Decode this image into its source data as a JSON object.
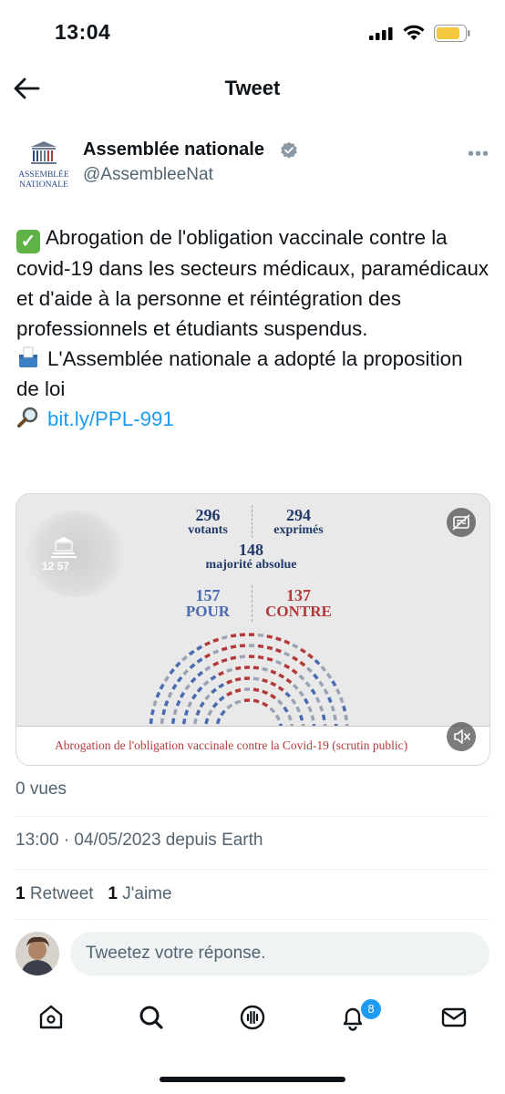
{
  "status_bar": {
    "time": "13:04"
  },
  "header": {
    "title": "Tweet"
  },
  "author": {
    "logo_text_line1": "ASSEMBLÉE",
    "logo_text_line2": "NATIONALE",
    "name": "Assemblée nationale",
    "handle": "@AssembleeNat",
    "verified": true,
    "more_label": "•••"
  },
  "tweet": {
    "emoji_check": "✓",
    "line1": "Abrogation de l'obligation vaccinale contre la covid-19 dans les secteurs médicaux, paramédicaux et d'aide à la personne et réintégration des professionnels et étudiants suspendus.",
    "line2": "L'Assemblée nationale a adopté la proposition de loi",
    "link": "bit.ly/PPL-991"
  },
  "media": {
    "clock": "12 57",
    "votants_num": "296",
    "votants_label": "votants",
    "exprimes_num": "294",
    "exprimes_label": "exprimés",
    "majorite_num": "148",
    "majorite_label": "majorité absolue",
    "pour_num": "157",
    "pour_label": "POUR",
    "contre_num": "137",
    "contre_label": "CONTRE",
    "caption": "Abrogation de l'obligation vaccinale contre la Covid-19 (scrutin public)",
    "colors": {
      "pour": "#4a6bb0",
      "contre": "#b33a3a",
      "abstention": "#9aa3b5"
    }
  },
  "meta": {
    "views": "0 vues",
    "timestamp": "13:00 · 04/05/2023 depuis Earth",
    "retweet_count": "1",
    "retweet_label": "Retweet",
    "like_count": "1",
    "like_label": "J'aime"
  },
  "reply": {
    "placeholder": "Tweetez votre réponse."
  },
  "nav": {
    "items": [
      "home-icon",
      "search-icon",
      "spaces-icon",
      "notifications-icon",
      "messages-icon"
    ],
    "notification_badge": "8"
  },
  "accent": "#1d9bf0"
}
